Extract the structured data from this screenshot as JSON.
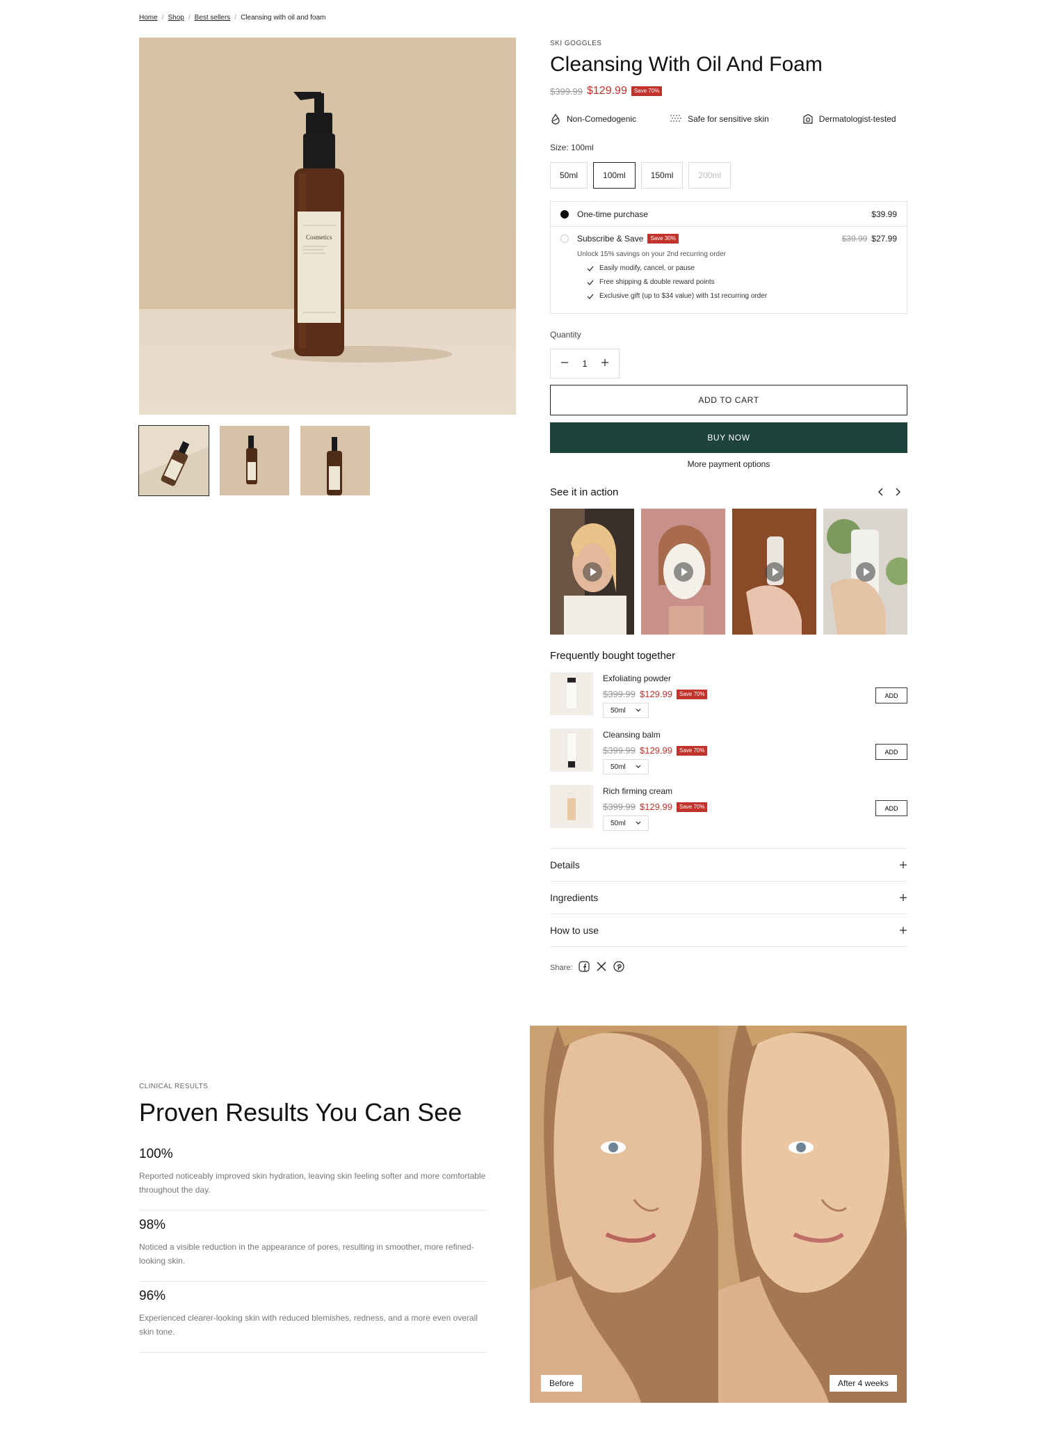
{
  "breadcrumb": {
    "items": [
      "Home",
      "Shop",
      "Best sellers"
    ],
    "current": "Cleansing with oil and foam",
    "separator": "/"
  },
  "product": {
    "vendor": "SKI GOGGLES",
    "title": "Cleansing With Oil And Foam",
    "compare_price": "$399.99",
    "price": "$129.99",
    "save_badge": "Save 70%",
    "bottle_label": "Cosmetics",
    "features": [
      {
        "icon": "drop-icon",
        "label": "Non-Comedogenic"
      },
      {
        "icon": "texture-icon",
        "label": "Safe for sensitive skin"
      },
      {
        "icon": "badge-icon",
        "label": "Dermatologist-tested"
      }
    ],
    "size_label": "Size:",
    "size_value": "100ml",
    "sizes": [
      "50ml",
      "100ml",
      "150ml",
      "200ml"
    ],
    "purchase": {
      "one_time_label": "One-time purchase",
      "one_time_price": "$39.99",
      "subscribe_label": "Subscribe & Save",
      "subscribe_badge": "Save 30%",
      "subscribe_compare": "$39.99",
      "subscribe_price": "$27.99",
      "unlock_text": "Unlock 15% savings on your 2nd recurring order",
      "benefits": [
        "Easily modify, cancel, or pause",
        "Free shipping & double reward points",
        "Exclusive gift (up to $34 value) with 1st recurring order"
      ]
    },
    "quantity_label": "Quantity",
    "quantity": "1",
    "add_to_cart": "ADD TO CART",
    "buy_now": "BUY NOW",
    "more_payment": "More payment options"
  },
  "see_it_in_action": {
    "title": "See it in action"
  },
  "frequently_bought": {
    "title": "Frequently bought together",
    "items": [
      {
        "name": "Exfoliating powder",
        "compare": "$399.99",
        "price": "$129.99",
        "badge": "Save 70%",
        "option": "50ml",
        "add": "ADD"
      },
      {
        "name": "Cleansing balm",
        "compare": "$399.99",
        "price": "$129.99",
        "badge": "Save 70%",
        "option": "50ml",
        "add": "ADD"
      },
      {
        "name": "Rich firming cream",
        "compare": "$399.99",
        "price": "$129.99",
        "badge": "Save 70%",
        "option": "50ml",
        "add": "ADD"
      }
    ]
  },
  "accordions": [
    "Details",
    "Ingredients",
    "How to use"
  ],
  "share": {
    "label": "Share:"
  },
  "clinical": {
    "eyebrow": "CLINICAL RESULTS",
    "title": "Proven Results You Can See",
    "stats": [
      {
        "value": "100%",
        "desc": "Reported noticeably improved skin hydration, leaving skin feeling softer and more comfortable throughout the day."
      },
      {
        "value": "98%",
        "desc": "Noticed a visible reduction in the appearance of pores, resulting in smoother, more refined-looking skin."
      },
      {
        "value": "96%",
        "desc": "Experienced clearer-looking skin with reduced blemishes, redness, and a more even overall skin tone."
      }
    ],
    "before_label": "Before",
    "after_label": "After 4 weeks"
  },
  "colors": {
    "sale": "#c2332b",
    "buy_now_bg": "#1e433d",
    "product_bg": "#d7c2a5"
  }
}
